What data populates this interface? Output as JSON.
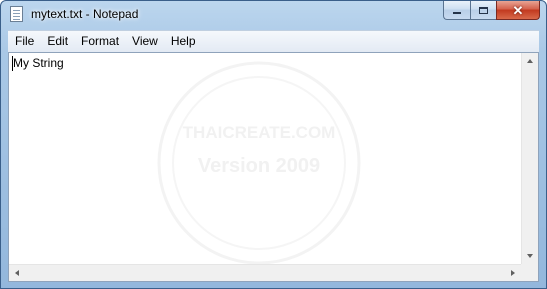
{
  "window": {
    "title": "mytext.txt - Notepad",
    "app_icon": "notepad-icon"
  },
  "caption_buttons": {
    "minimize": "minimize-icon",
    "maximize": "maximize-icon",
    "close": "close-icon"
  },
  "menu": {
    "items": [
      {
        "label": "File"
      },
      {
        "label": "Edit"
      },
      {
        "label": "Format"
      },
      {
        "label": "View"
      },
      {
        "label": "Help"
      }
    ]
  },
  "editor": {
    "content": "My String"
  },
  "watermark": {
    "line1": "THAICREATE.COM",
    "line2": "Version 2009"
  },
  "colors": {
    "titlebar": "#a9c8e6",
    "close_button": "#c2391f",
    "menubar": "#e3eaf4"
  }
}
